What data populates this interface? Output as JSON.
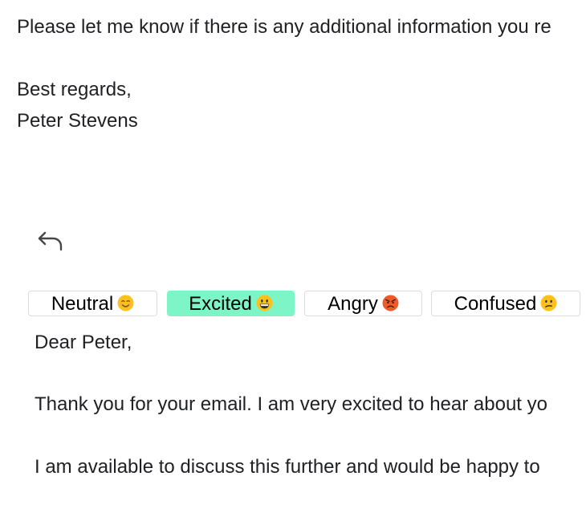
{
  "original_email": {
    "line1": "Please let me know if there is any additional information you re",
    "closing": "Best regards,",
    "signature": "Peter Stevens"
  },
  "reply": {
    "icon": "reply-icon"
  },
  "tones": [
    {
      "label": "Neutral",
      "icon": "smiling-face-icon",
      "selected": false
    },
    {
      "label": "Excited",
      "icon": "grinning-face-icon",
      "selected": true
    },
    {
      "label": "Angry",
      "icon": "angry-face-icon",
      "selected": false
    },
    {
      "label": "Confused",
      "icon": "confused-face-icon",
      "selected": false
    }
  ],
  "draft": {
    "greeting": "Dear Peter,",
    "paragraph1": "Thank you for your email. I am very excited to hear about yo",
    "paragraph2": "I am available to discuss this further and would be happy to"
  },
  "colors": {
    "selected_tone_bg": "#7df5c6",
    "text": "#202124",
    "button_border": "#dadce0"
  }
}
